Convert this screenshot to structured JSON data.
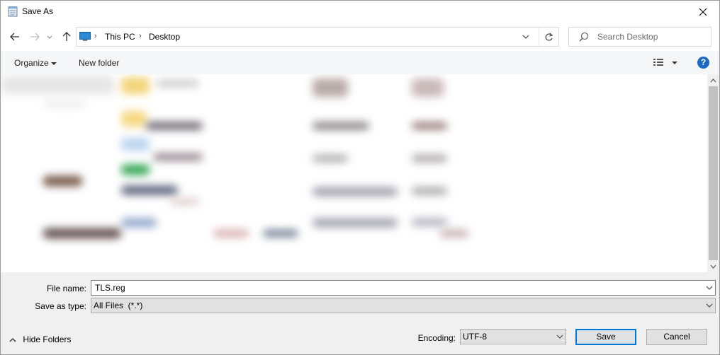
{
  "window": {
    "title": "Save As"
  },
  "nav": {
    "breadcrumbs": [
      "This PC",
      "Desktop"
    ],
    "search_placeholder": "Search Desktop"
  },
  "toolbar": {
    "organize_label": "Organize",
    "new_folder_label": "New folder",
    "help_label": "?"
  },
  "form": {
    "file_name_label": "File name:",
    "file_name_value": "TLS.reg",
    "save_as_type_label": "Save as type:",
    "save_as_type_value": "All Files  (*.*)",
    "encoding_label": "Encoding:",
    "encoding_value": "UTF-8"
  },
  "footer": {
    "hide_folders_label": "Hide Folders",
    "save_label": "Save",
    "cancel_label": "Cancel"
  },
  "icons": {
    "title": "notepad-icon",
    "close": "close-icon",
    "back": "back-arrow-icon",
    "forward": "forward-arrow-icon",
    "recent": "chevron-down-icon",
    "up": "up-arrow-icon",
    "pc": "this-pc-icon",
    "refresh": "refresh-icon",
    "search": "search-icon",
    "view": "view-options-icon",
    "help": "help-icon"
  },
  "colors": {
    "accent": "#0078d7",
    "toolbar_bg": "#f5f6f7",
    "footer_bg": "#f0f0f0",
    "help_blue": "#1a6ac5"
  }
}
